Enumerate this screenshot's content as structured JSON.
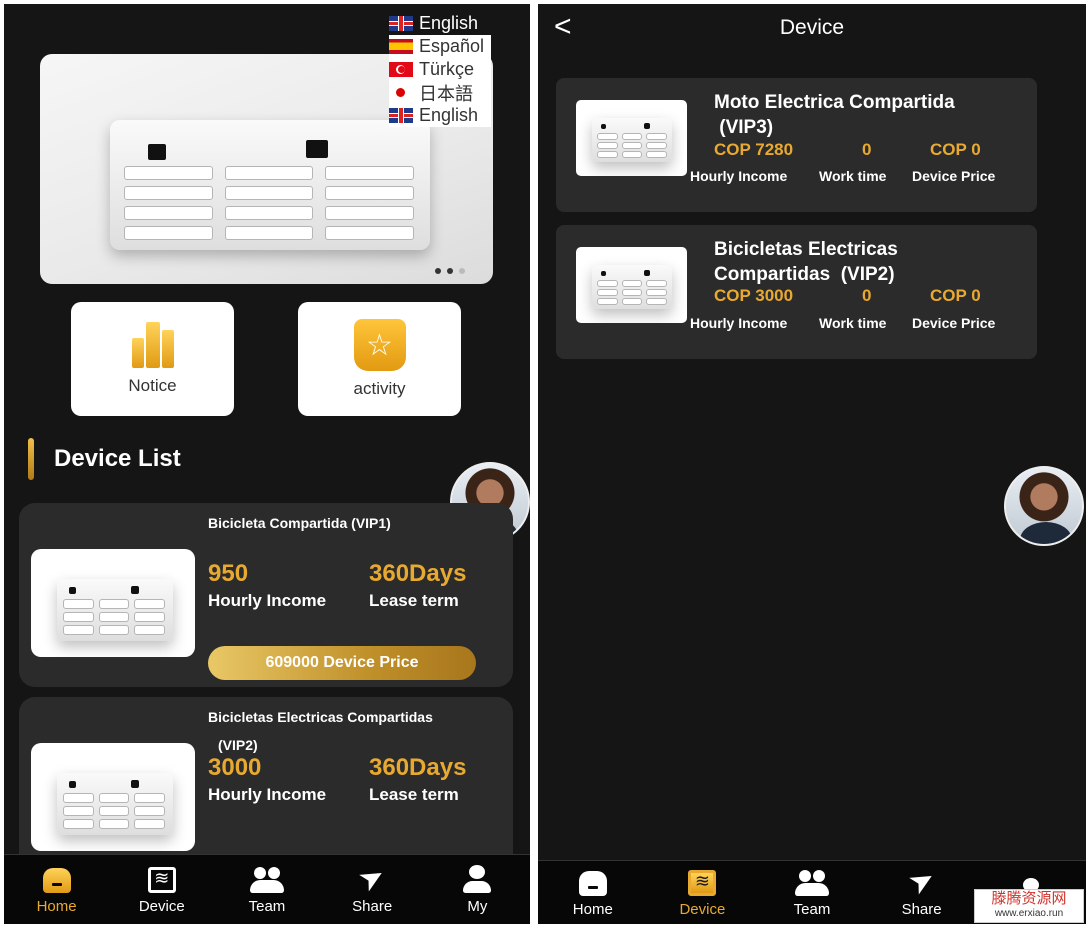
{
  "languages": [
    "English",
    "Español",
    "Türkçe",
    "日本語",
    "English"
  ],
  "home": {
    "shortcuts": {
      "notice": "Notice",
      "activity": "activity"
    },
    "section_title": "Device List",
    "devices": [
      {
        "name": "Bicicleta Compartida  (VIP1)",
        "hourly_income": "950",
        "hourly_income_label": "Hourly Income",
        "lease_term": "360Days",
        "lease_term_label": "Lease term",
        "price_button": "609000 Device Price"
      },
      {
        "name": "Bicicletas Electricas Compartidas",
        "name_line2": "(VIP2)",
        "hourly_income": "3000",
        "hourly_income_label": "Hourly Income",
        "lease_term": "360Days",
        "lease_term_label": "Lease term"
      }
    ]
  },
  "tabs": {
    "home": "Home",
    "device": "Device",
    "team": "Team",
    "share": "Share",
    "my": "My"
  },
  "device_page": {
    "back": "<",
    "title": "Device",
    "items": [
      {
        "name_line1": "Moto Electrica Compartida",
        "name_line2": " (VIP3)",
        "hourly_income": "COP 7280",
        "work_time": "0",
        "device_price": "COP 0"
      },
      {
        "name_line1": "Bicicletas Electricas",
        "name_line2": "Compartidas  (VIP2)",
        "hourly_income": "COP 3000",
        "work_time": "0",
        "device_price": "COP 0"
      }
    ],
    "labels": {
      "hourly_income": "Hourly Income",
      "work_time": "Work time",
      "device_price": "Device Price"
    }
  },
  "watermark": {
    "line1": "滕腾资源网",
    "line2": "www.erxiao.run"
  }
}
